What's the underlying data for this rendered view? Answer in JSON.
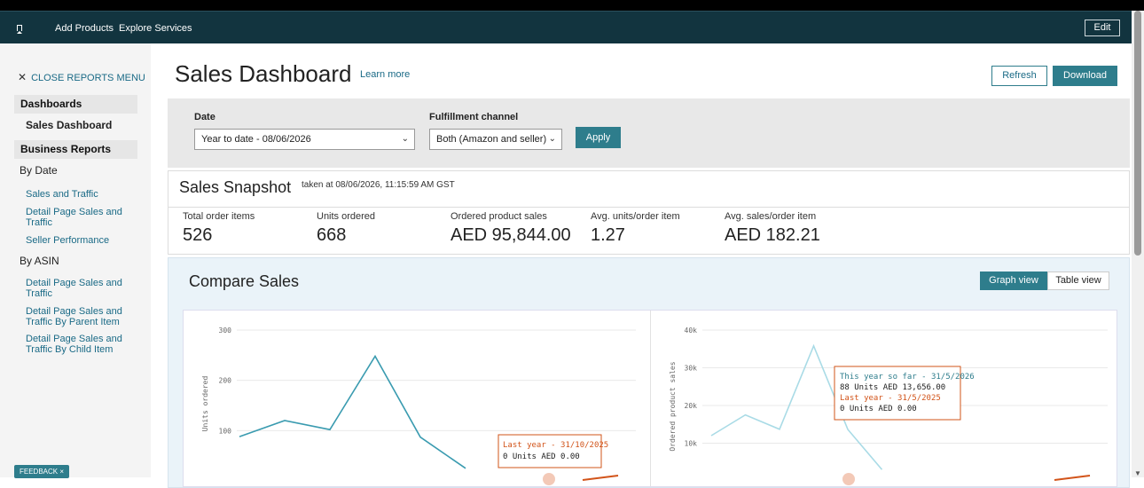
{
  "topbar": {
    "nav": [
      "Add Products",
      "Explore Services"
    ],
    "edit_label": "Edit"
  },
  "sidebar": {
    "close_label": "CLOSE REPORTS MENU",
    "dashboards_label": "Dashboards",
    "sales_dashboard_label": "Sales Dashboard",
    "business_reports_label": "Business Reports",
    "by_date_label": "By Date",
    "by_date_links": [
      "Sales and Traffic",
      "Detail Page Sales and Traffic",
      "Seller Performance"
    ],
    "by_asin_label": "By ASIN",
    "by_asin_links": [
      "Detail Page Sales and Traffic",
      "Detail Page Sales and Traffic By Parent Item",
      "Detail Page Sales and Traffic By Child Item"
    ],
    "feedback_label": "FEEDBACK ×"
  },
  "header": {
    "title": "Sales Dashboard",
    "learn_more": "Learn more",
    "refresh_label": "Refresh",
    "download_label": "Download"
  },
  "filters": {
    "date_label": "Date",
    "date_value": "Year to date - 08/06/2026",
    "channel_label": "Fulfillment channel",
    "channel_value": "Both (Amazon and seller)",
    "apply_label": "Apply"
  },
  "snapshot": {
    "title": "Sales Snapshot",
    "taken": "taken at 08/06/2026, 11:15:59 AM GST",
    "metrics": [
      {
        "label": "Total order items",
        "value": "526"
      },
      {
        "label": "Units ordered",
        "value": "668"
      },
      {
        "label": "Ordered product sales",
        "value": "AED 95,844.00"
      },
      {
        "label": "Avg. units/order item",
        "value": "1.27"
      },
      {
        "label": "Avg. sales/order item",
        "value": "AED 182.21"
      }
    ]
  },
  "compare": {
    "title": "Compare Sales",
    "graph_view_label": "Graph view",
    "table_view_label": "Table view",
    "units_chart": {
      "ylabel": "Units ordered",
      "yticks": [
        "300",
        "200",
        "100"
      ],
      "tooltip": {
        "title": "Last year - 31/10/2025",
        "line1": "0 Units AED 0.00"
      }
    },
    "sales_chart": {
      "ylabel": "Ordered product sales",
      "yticks": [
        "40k",
        "30k",
        "20k",
        "10k"
      ],
      "tooltip": {
        "title": "This year so far - 31/5/2026",
        "line1": "88 Units AED 13,656.00",
        "line2": "Last year - 31/5/2025",
        "line3": "0 Units AED 0.00"
      }
    }
  },
  "colors": {
    "topbar": "#12343f",
    "accent": "#2e7d8c",
    "this_year_line": "#3a9bb0",
    "last_year_line": "#d2541a"
  },
  "chart_data": [
    {
      "type": "line",
      "ylabel": "Units ordered",
      "ylim": [
        0,
        300
      ],
      "series": [
        {
          "values": [
            88,
            120,
            102,
            248,
            87,
            25
          ]
        }
      ]
    },
    {
      "type": "line",
      "ylabel": "Ordered product sales",
      "ylim": [
        0,
        40000
      ],
      "series": [
        {
          "values": [
            12000,
            17500,
            13700,
            35800,
            13656,
            3000
          ]
        }
      ]
    }
  ]
}
